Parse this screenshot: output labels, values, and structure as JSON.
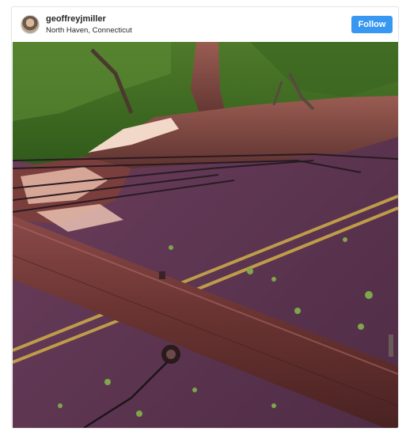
{
  "post": {
    "username": "geoffreyjmiller",
    "location": "North Haven, Connecticut",
    "follow_label": "Follow"
  },
  "colors": {
    "follow_button": "#3897f0",
    "username_text": "#262626"
  },
  "icons": {
    "avatar": "user-profile-photo"
  }
}
